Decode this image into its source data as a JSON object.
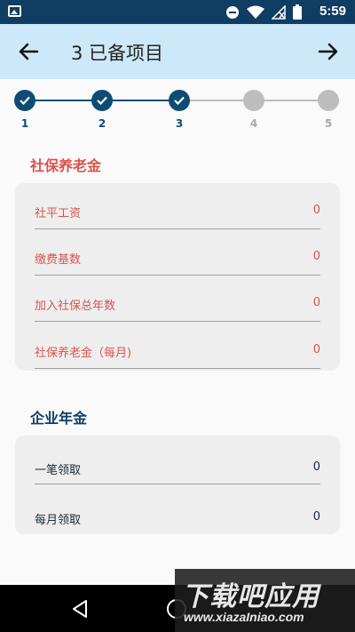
{
  "status_bar": {
    "time": "5:59",
    "icons": [
      "image-icon",
      "do-not-disturb-icon",
      "wifi-icon",
      "signal-icon",
      "battery-icon"
    ]
  },
  "app_bar": {
    "title": "3 已备项目",
    "back_icon": "arrow-left-icon",
    "forward_icon": "arrow-right-icon"
  },
  "stepper": {
    "current_step": 3,
    "steps": [
      {
        "label": "1",
        "state": "done"
      },
      {
        "label": "2",
        "state": "done"
      },
      {
        "label": "3",
        "state": "done"
      },
      {
        "label": "4",
        "state": "todo"
      },
      {
        "label": "5",
        "state": "todo"
      }
    ],
    "colors": {
      "done": "#0e4c74",
      "todo": "#bdbdbd"
    }
  },
  "pension": {
    "title": "社保养老金",
    "rows": [
      {
        "label": "社平工资",
        "value": "0"
      },
      {
        "label": "缴费基数",
        "value": "0"
      },
      {
        "label": "加入社保总年数",
        "value": "0"
      },
      {
        "label": "社保养老金（每月)",
        "value": "0"
      }
    ],
    "accent": "#d9534f"
  },
  "annuity": {
    "title": "企业年金",
    "rows": [
      {
        "label": "一笔领取",
        "value": "0"
      },
      {
        "label": "每月领取",
        "value": "0"
      }
    ],
    "accent": "#0f3d63"
  },
  "watermark": {
    "main": "下载吧应用",
    "sub": "www.xiazaIniao.com"
  }
}
